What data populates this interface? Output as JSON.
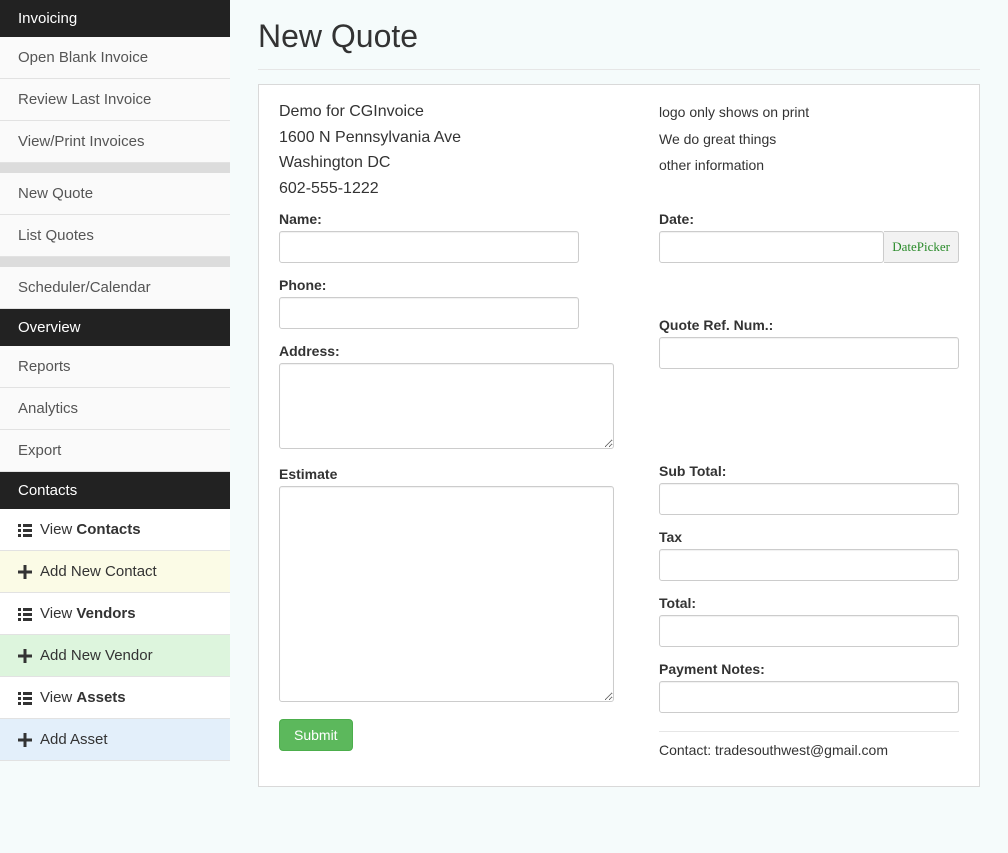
{
  "sidebar": {
    "sections": [
      {
        "header": "Invoicing",
        "items": [
          "Open Blank Invoice",
          "Review Last Invoice",
          "View/Print Invoices"
        ]
      },
      {
        "spacer": true,
        "items": [
          "New Quote",
          "List Quotes"
        ]
      },
      {
        "spacer": true,
        "items": [
          "Scheduler/Calendar"
        ]
      },
      {
        "header": "Overview",
        "items": [
          "Reports",
          "Analytics",
          "Export"
        ]
      },
      {
        "header": "Contacts",
        "contact_items": [
          {
            "icon": "list",
            "prefix": "View ",
            "bold": "Contacts",
            "class": "ci-white"
          },
          {
            "icon": "plus",
            "text": "Add New Contact",
            "class": "ci-yellow"
          },
          {
            "icon": "list",
            "prefix": "View ",
            "bold": "Vendors",
            "class": "ci-white"
          },
          {
            "icon": "plus",
            "text": "Add New Vendor",
            "class": "ci-green"
          },
          {
            "icon": "list",
            "prefix": "View ",
            "bold": "Assets",
            "class": "ci-white"
          },
          {
            "icon": "plus",
            "text": "Add Asset",
            "class": "ci-blue"
          }
        ]
      }
    ]
  },
  "page": {
    "title": "New Quote"
  },
  "company": {
    "name": "Demo for CGInvoice",
    "street": "1600 N Pennsylvania Ave",
    "city": "Washington DC",
    "phone": "602-555-1222"
  },
  "company_right": {
    "line1": "logo only shows on print",
    "line2": "We do great things",
    "line3": "other information"
  },
  "fields": {
    "name_label": "Name:",
    "phone_label": "Phone:",
    "address_label": "Address:",
    "estimate_label": "Estimate",
    "date_label": "Date:",
    "date_picker": "DatePicker",
    "quote_ref_label": "Quote Ref. Num.:",
    "subtotal_label": "Sub Total:",
    "tax_label": "Tax",
    "total_label": "Total:",
    "payment_notes_label": "Payment Notes:"
  },
  "submit": "Submit",
  "footer_contact": "Contact: tradesouthwest@gmail.com"
}
